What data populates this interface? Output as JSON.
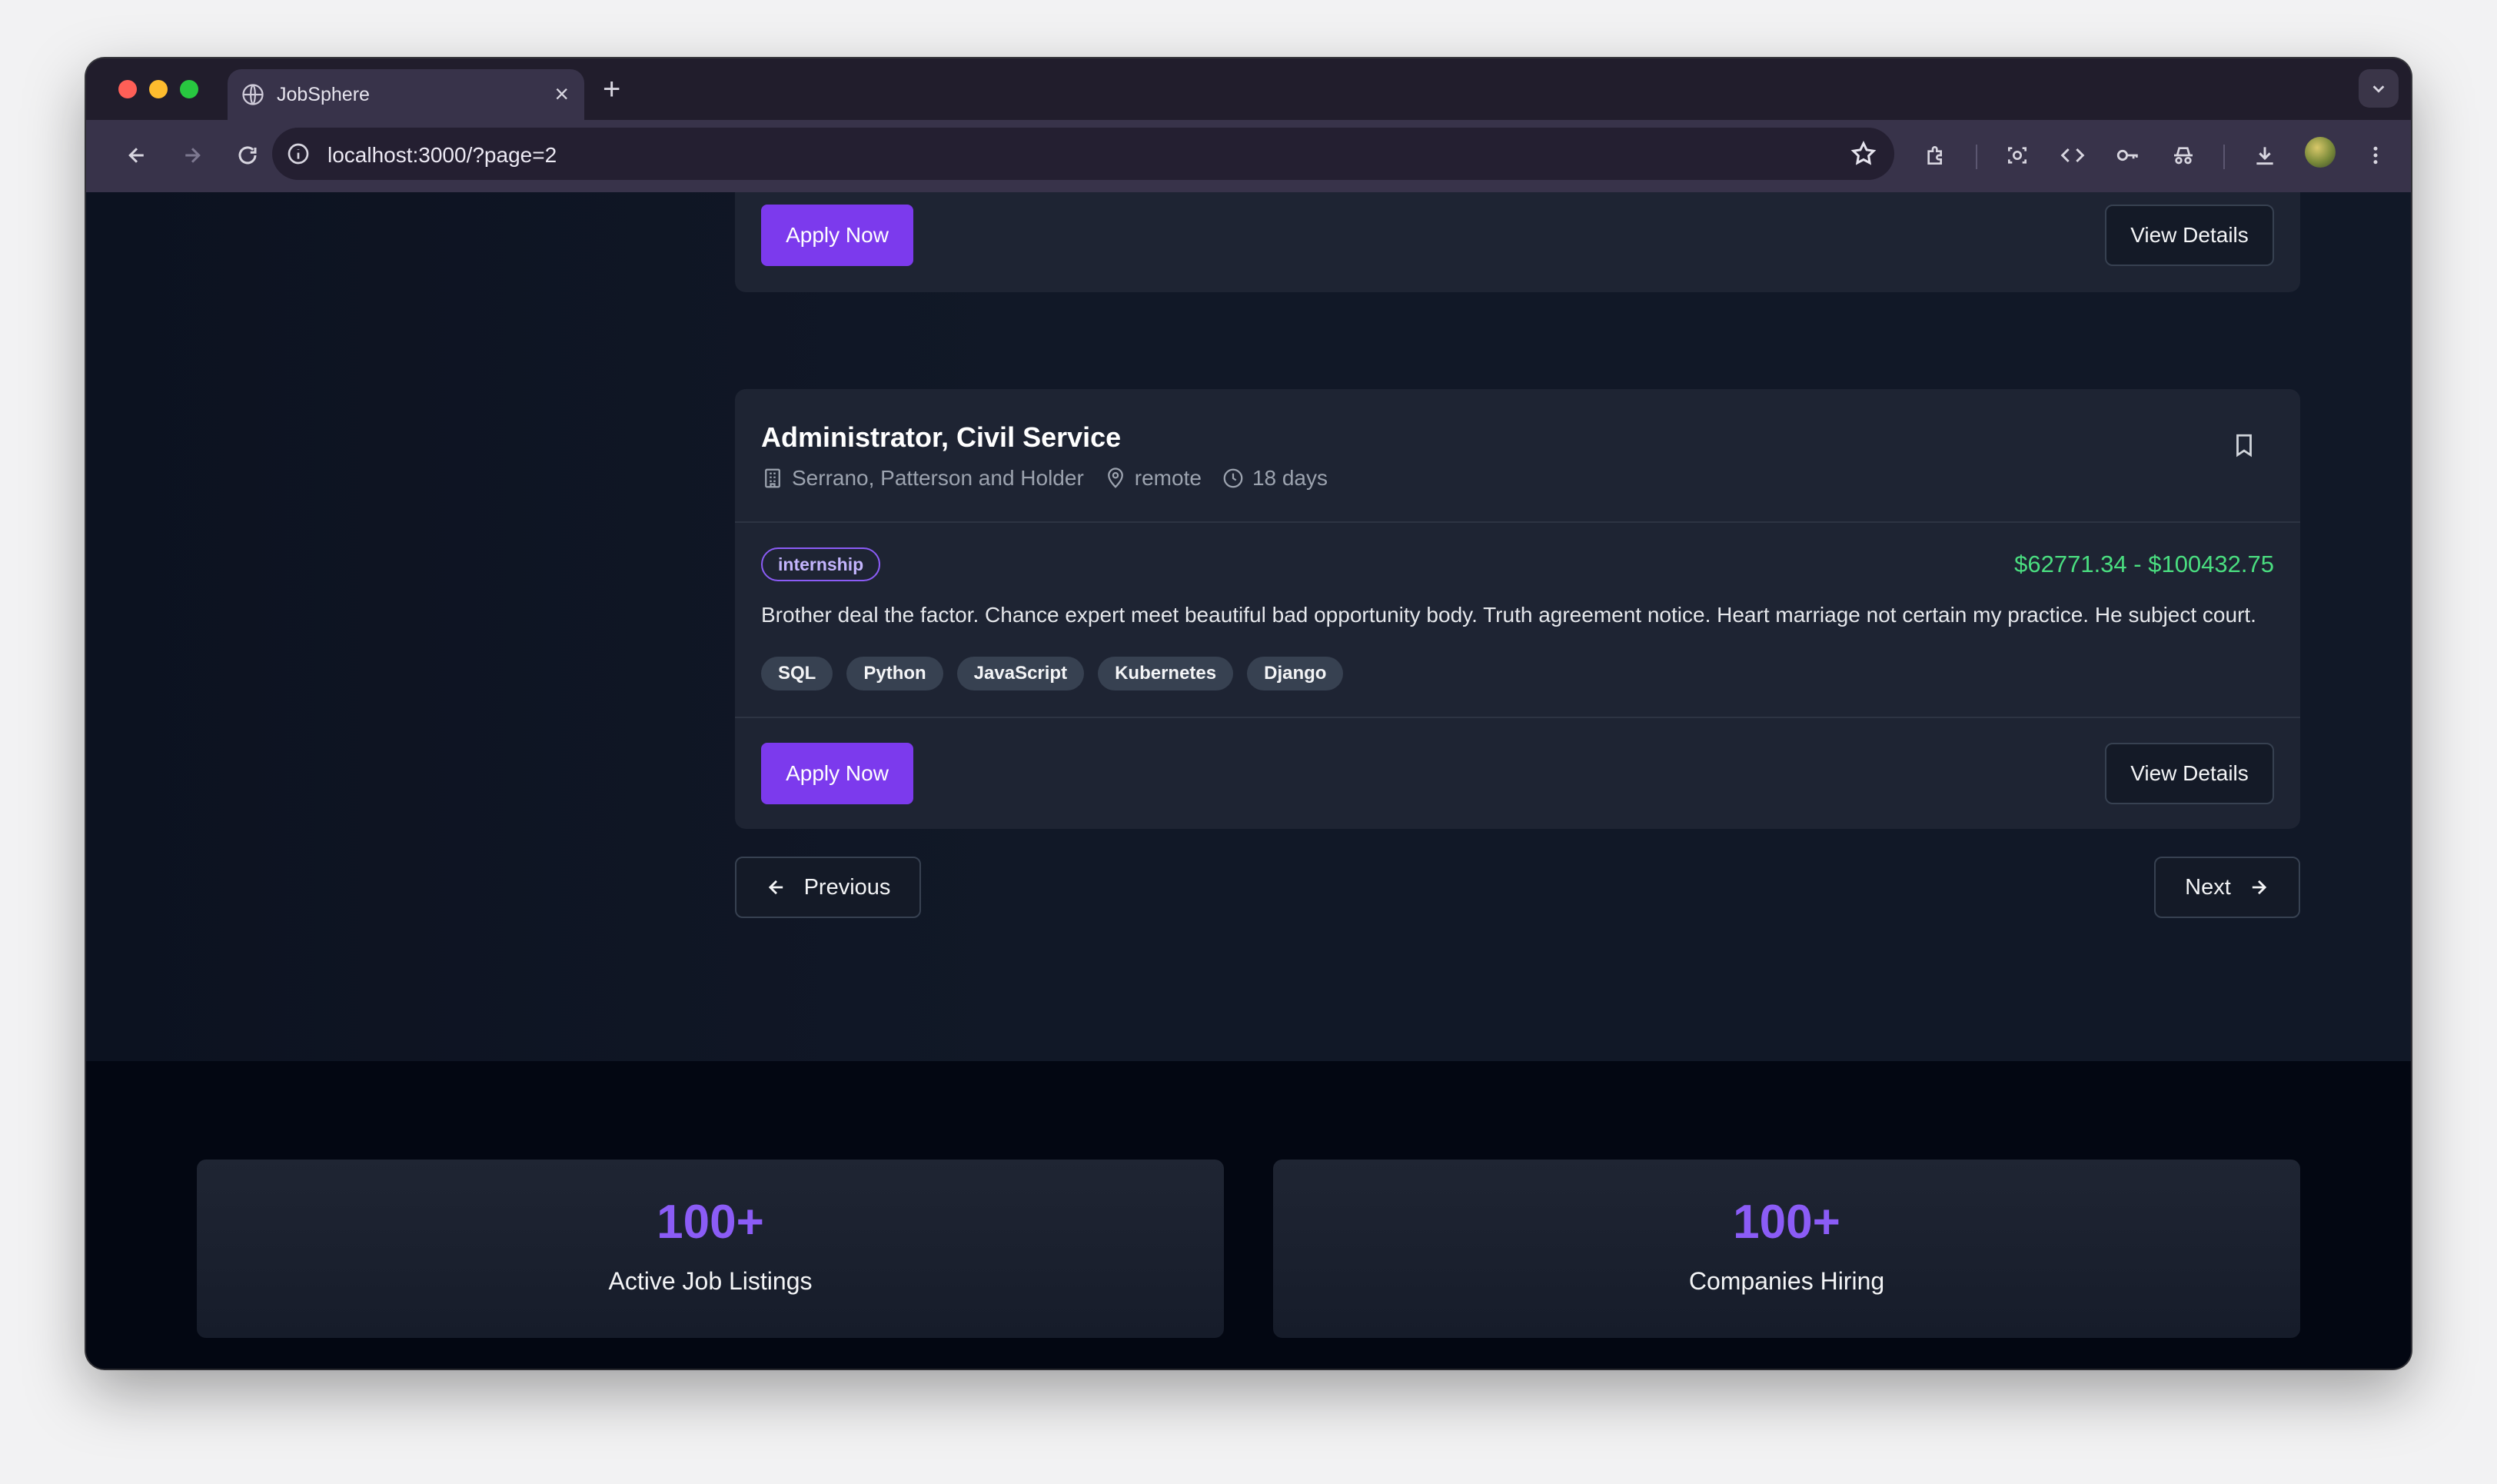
{
  "browser": {
    "tab_title": "JobSphere",
    "tab_close": "×",
    "new_tab": "+",
    "url": "localhost:3000/?page=2"
  },
  "previous_card": {
    "apply_label": "Apply Now",
    "details_label": "View Details"
  },
  "job": {
    "title": "Administrator, Civil Service",
    "company": "Serrano, Patterson and Holder",
    "location": "remote",
    "posted": "18 days",
    "type": "internship",
    "salary": "$62771.34 - $100432.75",
    "description": "Brother deal the factor. Chance expert meet beautiful bad opportunity body. Truth agreement notice. Heart marriage not certain my practice. He subject court.",
    "skills": [
      "SQL",
      "Python",
      "JavaScript",
      "Kubernetes",
      "Django"
    ],
    "apply_label": "Apply Now",
    "details_label": "View Details"
  },
  "pagination": {
    "previous_label": "Previous",
    "next_label": "Next"
  },
  "stats": [
    {
      "value": "100+",
      "label": "Active Job Listings"
    },
    {
      "value": "100+",
      "label": "Companies Hiring"
    }
  ],
  "colors": {
    "accent": "#7c3aed",
    "salary": "#4ade80",
    "stat_number": "#8b5cf6"
  }
}
